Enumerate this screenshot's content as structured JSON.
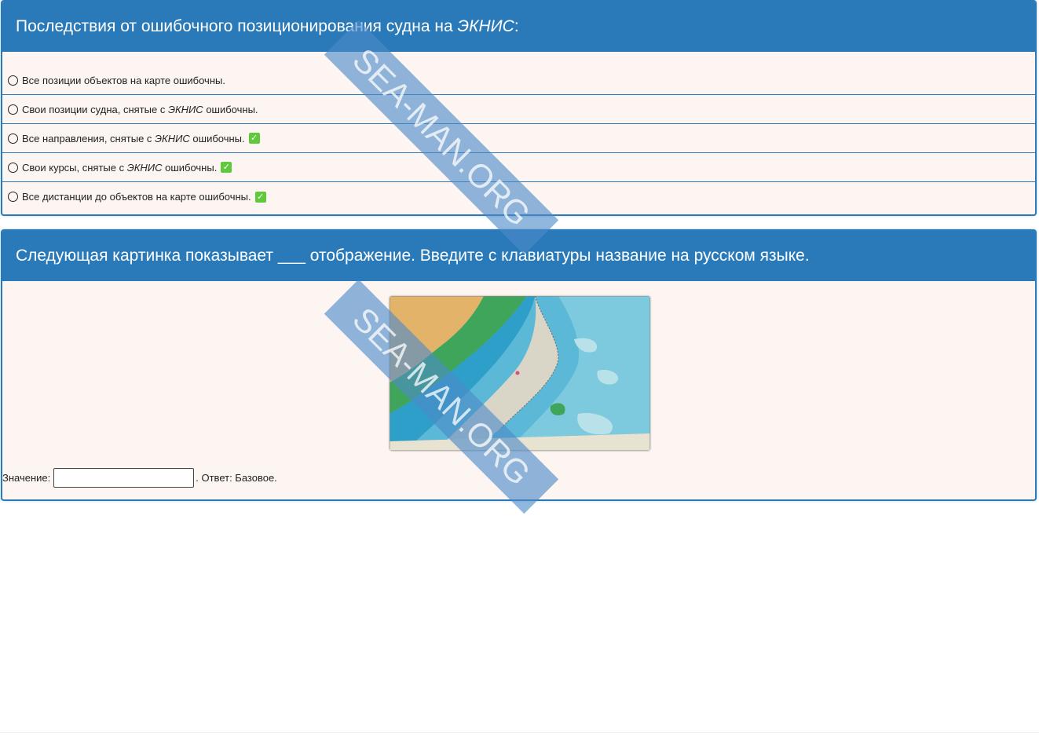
{
  "question1": {
    "title_prefix": "Последствия от ошибочного позиционирования судна на ",
    "title_em": "ЭКНИС",
    "title_suffix": ":",
    "options": [
      {
        "text": "Все позиции объектов на карте ошибочны.",
        "checked": false
      },
      {
        "pre": "Свои позиции судна, снятые с ",
        "em": "ЭКНИС",
        "post": " ошибочны.",
        "checked": false
      },
      {
        "pre": "Все направления, снятые с ",
        "em": "ЭКНИС",
        "post": " ошибочны.",
        "checked": true
      },
      {
        "pre": "Свои курсы, снятые с ",
        "em": "ЭКНИС",
        "post": " ошибочны.",
        "checked": true
      },
      {
        "text": "Все дистанции до объектов на карте ошибочны.",
        "checked": true
      }
    ]
  },
  "question2": {
    "title": "Следующая картинка показывает ___ отображение. Введите с клавиатуры название на русском языке.",
    "value_label": "Значение:",
    "input_value": "",
    "answer_text": ". Ответ: Базовое."
  },
  "watermark": "SEA-MAN.ORG",
  "colors": {
    "header_blue": "#2a7ab9",
    "panel_bg": "#fdf5f1",
    "check_green": "#5ec93b"
  }
}
